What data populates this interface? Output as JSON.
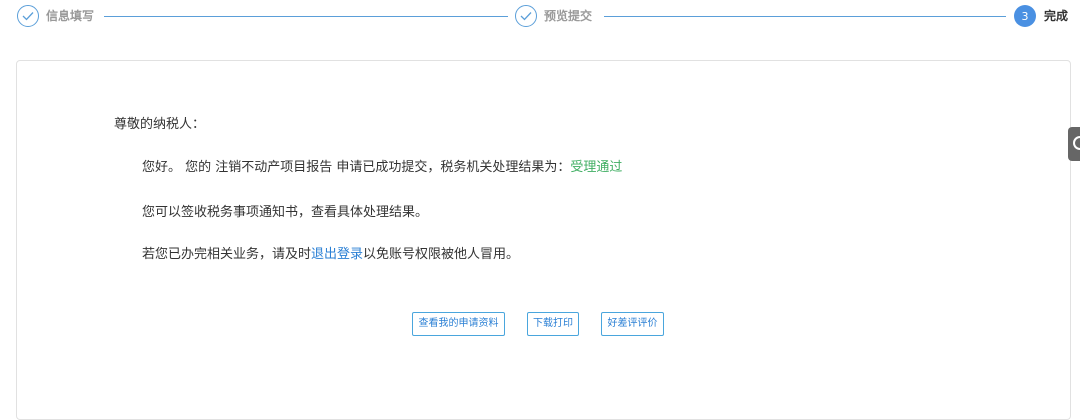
{
  "steps": [
    {
      "label": "信息填写",
      "state": "done"
    },
    {
      "label": "预览提交",
      "state": "done"
    },
    {
      "label": "完成",
      "number": "3",
      "state": "active"
    }
  ],
  "notice": {
    "salutation": "尊敬的纳税人：",
    "line1_prefix": "您好。 您的 注销不动产项目报告 申请已成功提交，税务机关处理结果为：",
    "result": "受理通过",
    "line2": "您可以签收税务事项通知书，查看具体处理结果。",
    "line3_prefix": "若您已办完相关业务，请及时",
    "logout_link": "退出登录",
    "line3_suffix": "以免账号权限被他人冒用。"
  },
  "buttons": {
    "view_application": "查看我的申请资料",
    "download_print": "下载打印",
    "rate": "好差评评价"
  },
  "colors": {
    "accent": "#4a90e2",
    "success": "#3fae62",
    "link": "#2a7fd4"
  }
}
